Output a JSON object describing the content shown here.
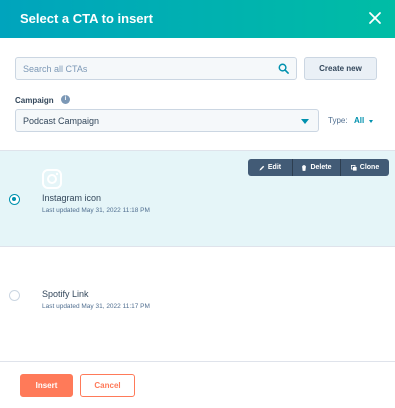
{
  "modal": {
    "title": "Select a CTA to insert"
  },
  "search": {
    "placeholder": "Search all CTAs",
    "value": ""
  },
  "toolbar": {
    "create_label": "Create new"
  },
  "campaign": {
    "label": "Campaign",
    "selected": "Podcast Campaign"
  },
  "type_filter": {
    "label": "Type:",
    "value": "All"
  },
  "ctas": [
    {
      "name": "Instagram icon",
      "updated": "Last updated May 31, 2022 11:18 PM",
      "selected": true,
      "thumbnail_icon": "instagram-icon"
    },
    {
      "name": "Spotify Link",
      "updated": "Last updated May 31, 2022 11:17 PM",
      "selected": false
    }
  ],
  "row_actions": {
    "edit": "Edit",
    "delete": "Delete",
    "clone": "Clone"
  },
  "footer": {
    "insert_label": "Insert",
    "cancel_label": "Cancel"
  },
  "colors": {
    "header_gradient_start": "#00a4bd",
    "header_gradient_end": "#00bda5",
    "accent": "#0091ae",
    "primary_button": "#ff7a59",
    "selected_row": "#e5f5f8",
    "action_bar": "#425b76"
  }
}
